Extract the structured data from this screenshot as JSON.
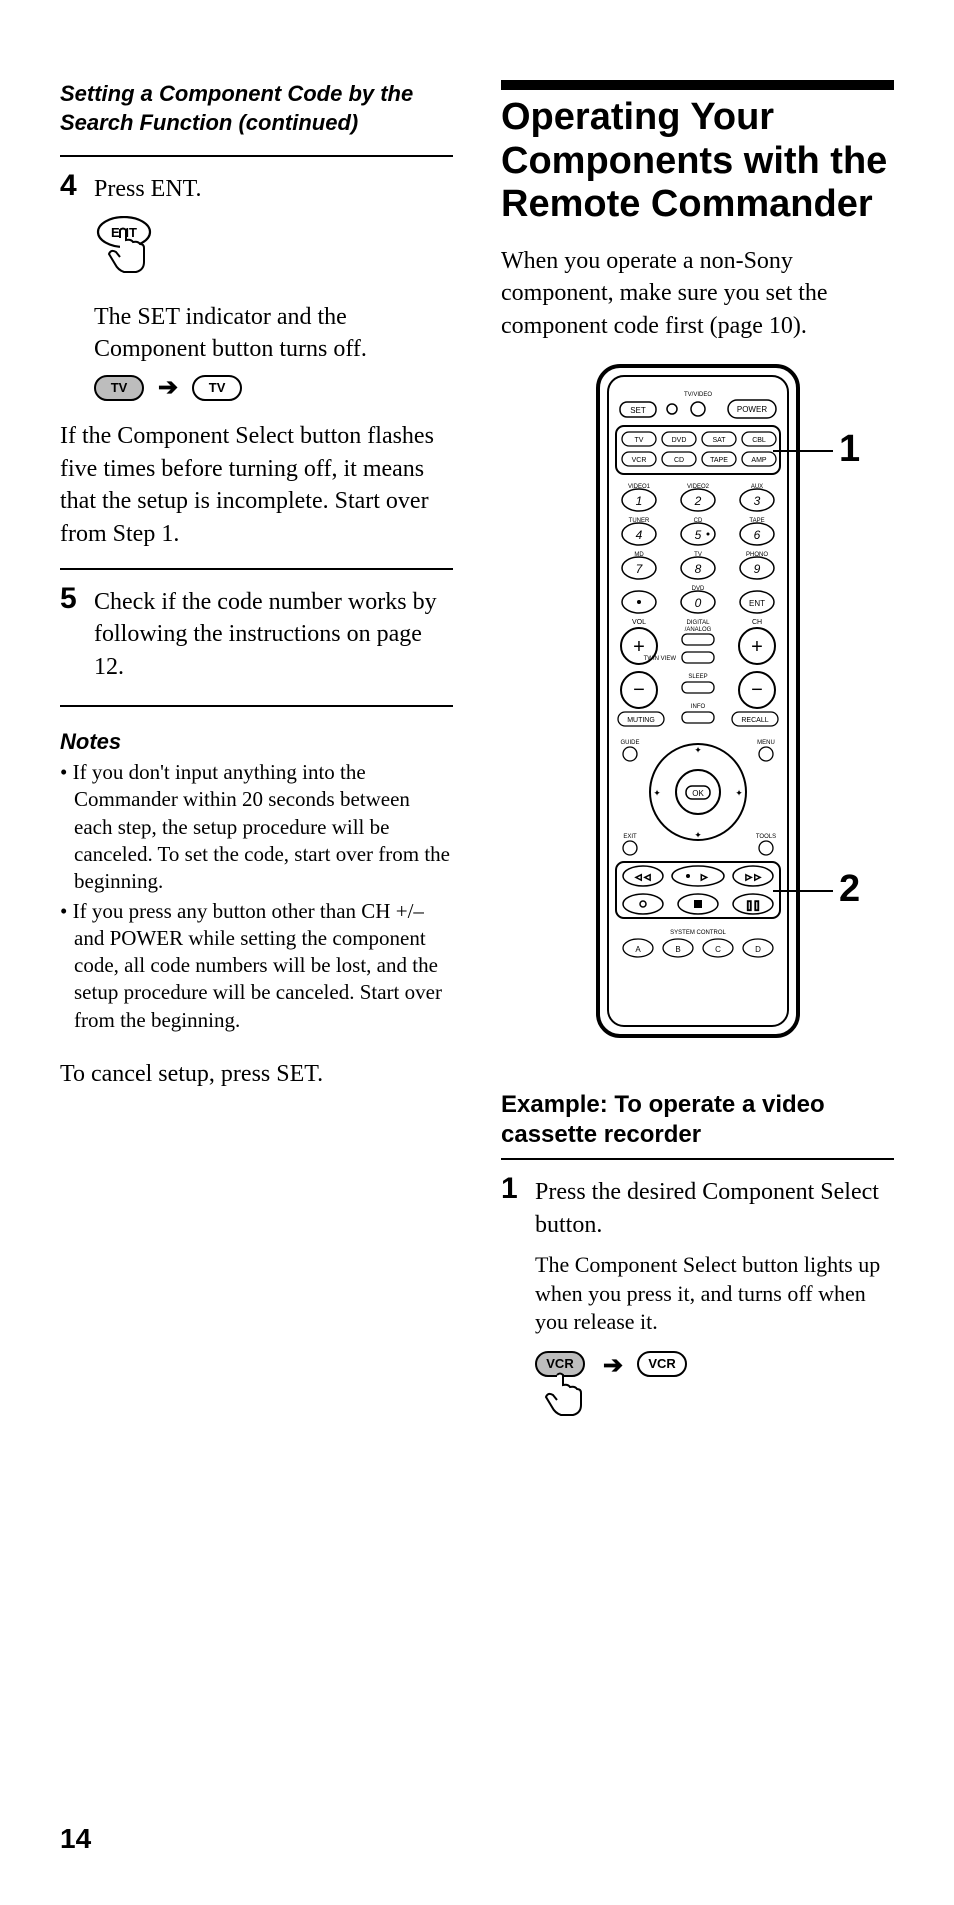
{
  "left": {
    "continued_title": "Setting a Component Code by the Search Function (continued)",
    "step4": {
      "num": "4",
      "text": "Press ENT.",
      "ent_label": "ENT",
      "detail": "The SET indicator and the Component button turns off.",
      "tv_label": "TV",
      "aftertext": "If the Component Select button flashes five times before turning off, it means that the setup is incomplete. Start over from Step 1."
    },
    "step5": {
      "num": "5",
      "text": "Check if the code number works by following the instructions on page 12."
    },
    "notes_head": "Notes",
    "notes": [
      "If you don't input anything into the Commander within 20 seconds between each step, the setup procedure will be canceled. To set the code, start over from the beginning.",
      "If you press any button other than CH +/– and POWER while setting the component code, all code numbers will be lost, and the setup procedure will be canceled. Start over from the beginning."
    ],
    "cancel": "To cancel setup, press SET."
  },
  "right": {
    "title": "Operating Your Components with the Remote Commander",
    "intro": "When you operate a non-Sony component, make sure you set the component code first (page 10).",
    "callout1": "1",
    "callout2": "2",
    "remote_labels": {
      "set": "SET",
      "tvvideo": "TV/VIDEO",
      "power": "POWER",
      "tv": "TV",
      "dvd": "DVD",
      "sat": "SAT",
      "cbl": "CBL",
      "vcr": "VCR",
      "cd": "CD",
      "tape": "TAPE",
      "amp": "AMP",
      "video1": "VIDEO1",
      "video2": "VIDEO2",
      "aux": "AUX",
      "tuner": "TUNER",
      "cd2": "CD",
      "tape2": "TAPE",
      "md": "MD",
      "tv2": "TV",
      "phono": "PHONO",
      "dvd2": "DVD",
      "ent": "ENT",
      "vol": "VOL",
      "digital": "DIGITAL\n/ANALOG",
      "ch": "CH",
      "twinview": "TWIN VIEW",
      "sleep": "SLEEP",
      "info": "INFO",
      "muting": "MUTING",
      "recall": "RECALL",
      "guide": "GUIDE",
      "menu": "MENU",
      "ok": "OK",
      "exit": "EXIT",
      "tools": "TOOLS",
      "system": "SYSTEM CONTROL",
      "a": "A",
      "b": "B",
      "c": "C",
      "d": "D"
    },
    "example_head": "Example:  To operate a video cassette recorder",
    "ex_step1": {
      "num": "1",
      "text": "Press the desired Component Select button.",
      "detail": "The Component Select button lights up when you press it, and turns off when you release it.",
      "vcr_label": "VCR"
    }
  },
  "page_number": "14"
}
